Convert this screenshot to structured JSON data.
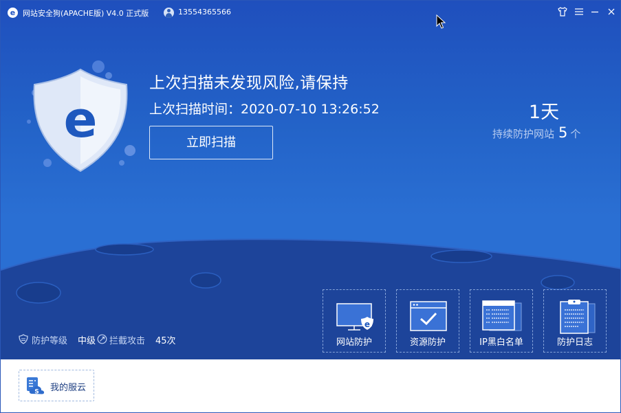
{
  "titlebar": {
    "app_title": "网站安全狗(APACHE版) V4.0 正式版",
    "logo_letter": "e",
    "phone": "13554365566"
  },
  "hero": {
    "scan_title": "上次扫描未发现风险,请保持",
    "scan_time": "上次扫描时间：2020-07-10 13:26:52",
    "scan_button": "立即扫描",
    "days": "1天",
    "protect_prefix": "持续防护网站",
    "protect_count": "5",
    "protect_unit": "个"
  },
  "status": {
    "level_label": "防护等级",
    "level_value": "中级",
    "attack_label": "拦截攻击",
    "attack_value": "45次"
  },
  "tiles": [
    {
      "label": "网站防护",
      "icon": "monitor-shield-icon"
    },
    {
      "label": "资源防护",
      "icon": "window-check-icon"
    },
    {
      "label": "IP黑白名单",
      "icon": "ip-list-icon"
    },
    {
      "label": "防护日志",
      "icon": "clipboard-log-icon"
    }
  ],
  "bottom": {
    "cloud_label": "我的服云"
  },
  "colors": {
    "hero_blue": "#2363c8",
    "moon_blue": "#1d449a",
    "accent_white": "#ffffff"
  }
}
